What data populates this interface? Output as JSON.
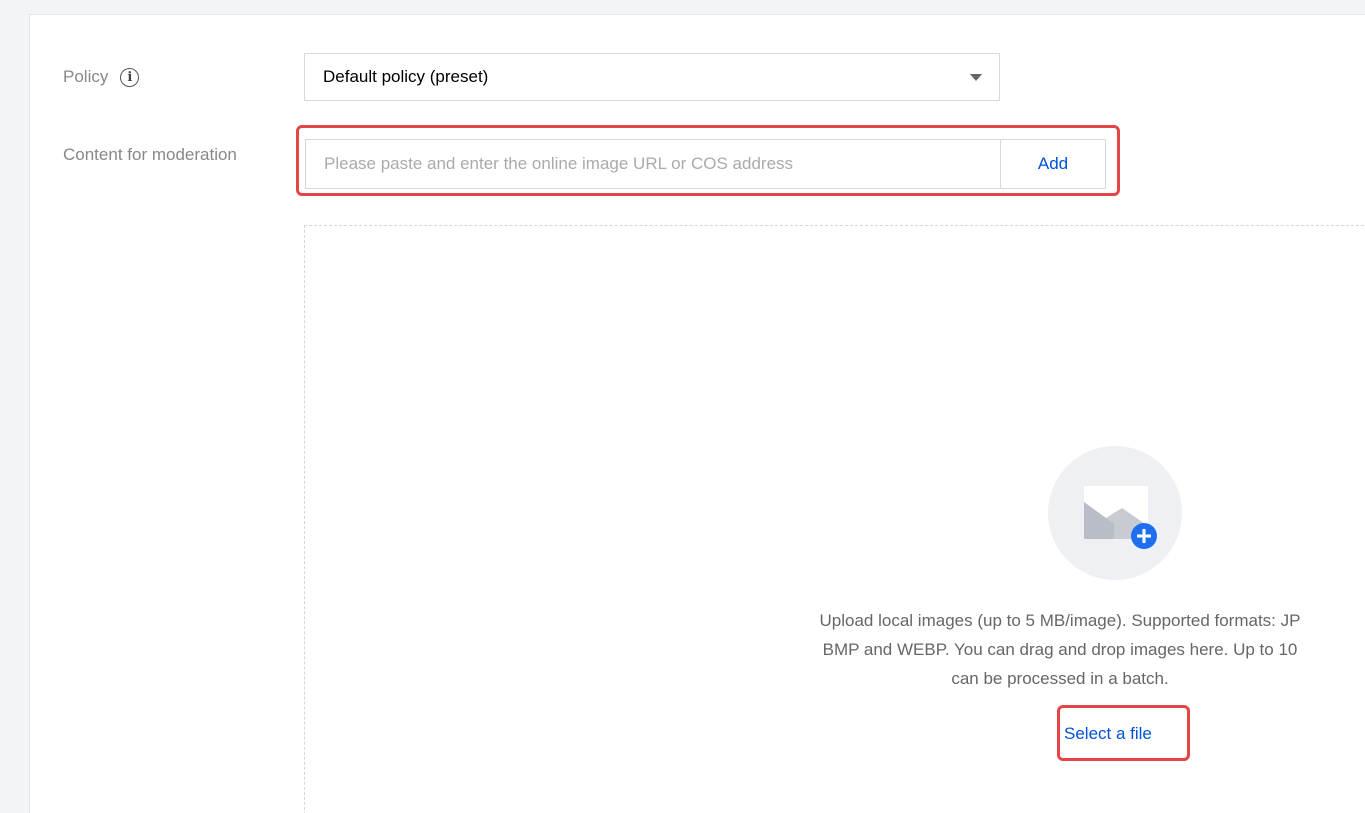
{
  "form": {
    "policy_label": "Policy",
    "policy_info_icon": "info-icon",
    "policy_value": "Default policy (preset)",
    "content_label": "Content for moderation",
    "url_input_value": "",
    "url_placeholder": "Please paste and enter the online image URL or COS address",
    "add_button": "Add"
  },
  "upload": {
    "icon": "image-add-icon",
    "description_lines": [
      "Upload local images (up to 5 MB/image). Supported formats: JP",
      "BMP and WEBP. You can drag and drop images here. Up to 10",
      "can be processed in a batch."
    ],
    "select_file_link": "Select a file"
  },
  "colors": {
    "accent": "#0052d9",
    "highlight": "#e54545",
    "plus_badge": "#1e6ff0"
  }
}
